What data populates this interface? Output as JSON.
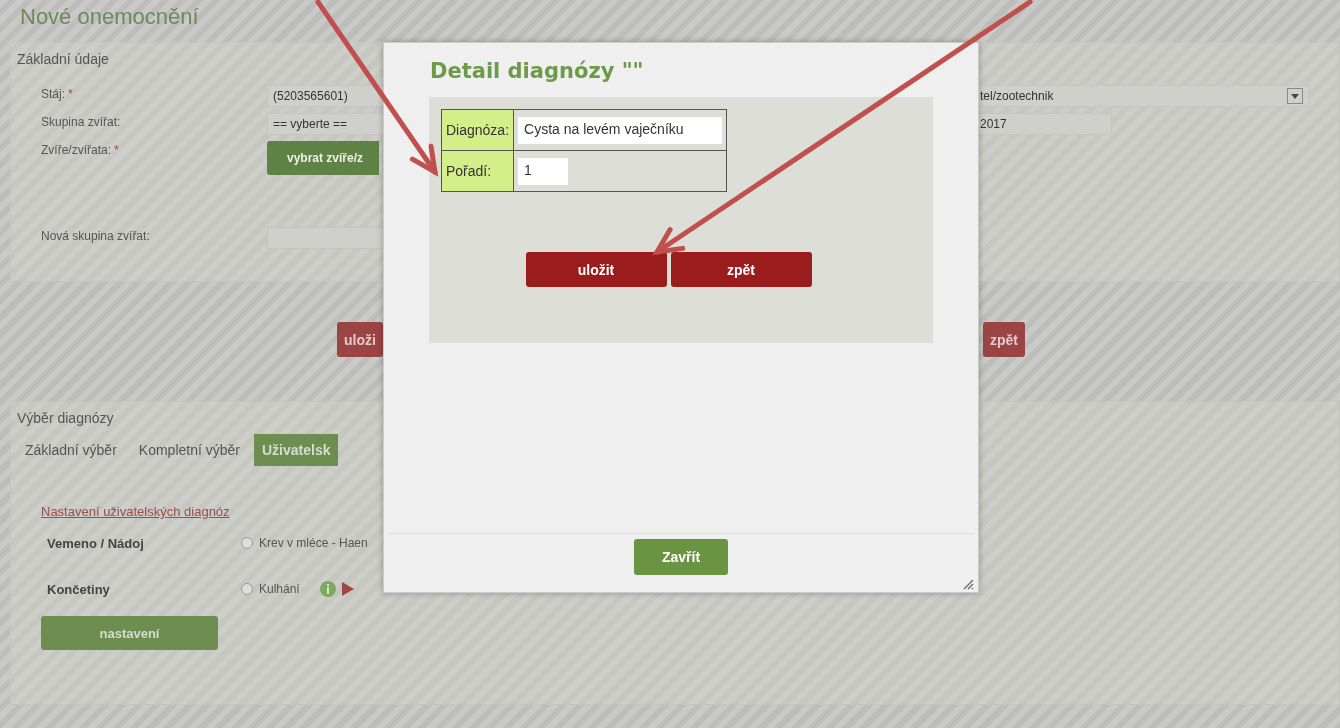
{
  "page_title": "Nové onemocnění",
  "basic_panel": {
    "title": "Základní údaje",
    "rows": [
      {
        "label": "Stáj:",
        "required_mark": "*",
        "kind": "text",
        "value": "(5203565601)"
      },
      {
        "label": "Skupina zvířat:",
        "kind": "text",
        "value": "== vyberte =="
      },
      {
        "label": "Zvíře/zvířata:",
        "required_mark": "*",
        "kind": "button",
        "value": "vybrat zvíře/z"
      },
      {
        "label": "Nová skupina zvířat:",
        "kind": "text"
      }
    ],
    "right_fields": [
      {
        "kind": "select",
        "value": "tel/zootechnik"
      },
      {
        "kind": "text",
        "value": "2017"
      }
    ],
    "buttons": [
      "uloži",
      "zpět"
    ]
  },
  "diagnosis_panel": {
    "title": "Výběr diagnózy",
    "tabs": [
      {
        "label": "Základní výběr",
        "selected": false
      },
      {
        "label": "Kompletní výběr",
        "selected": false
      },
      {
        "label": "Uživatelsk",
        "selected": true
      }
    ],
    "link": "Nastavení uživatelských diagnóz",
    "groups": [
      {
        "name": "Vemeno / Nádoj",
        "options": [
          {
            "label": "Krev v mléce - Haen",
            "checked": false,
            "actions": false
          }
        ]
      },
      {
        "name": "Končetiny",
        "options": [
          {
            "label": "Kulhání",
            "checked": false,
            "actions": true
          }
        ]
      }
    ],
    "button": "nastavení"
  },
  "dialog": {
    "title": "Detail diagnózy \"\"",
    "fields": [
      {
        "label": "Diagnóza:",
        "value": "Cysta na levém vaječníku",
        "kind": "wide"
      },
      {
        "label": "Pořadí:",
        "value": "1",
        "kind": "narrow"
      }
    ],
    "buttons": [
      "uložit",
      "zpět"
    ],
    "close_button": "Zavřít"
  }
}
